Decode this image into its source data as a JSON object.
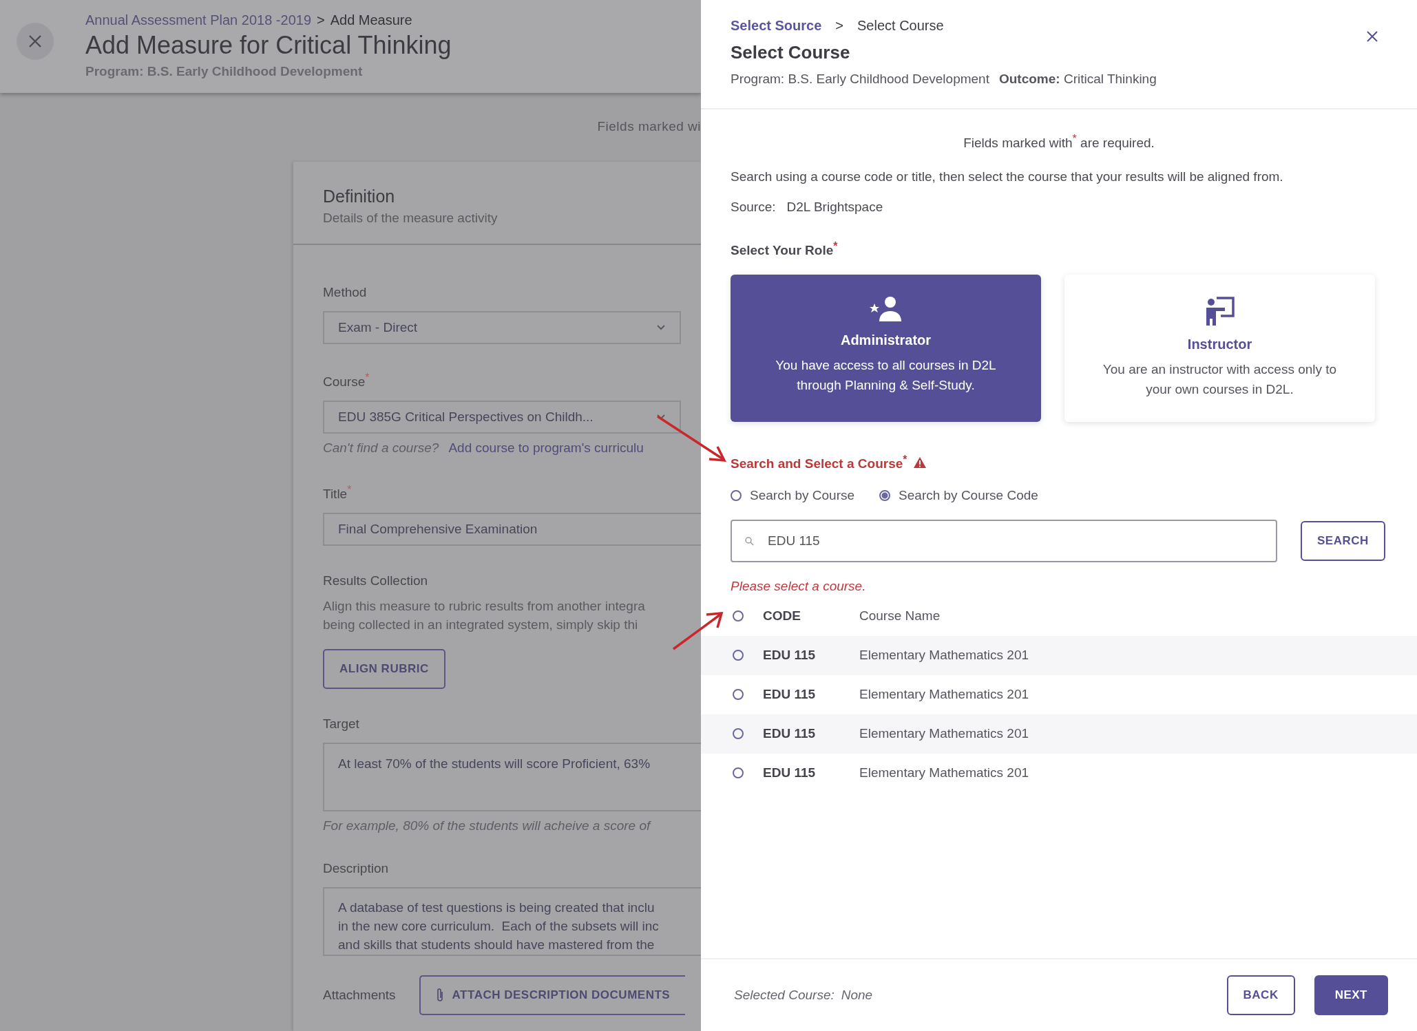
{
  "page": {
    "breadcrumb": {
      "link": "Annual Assessment Plan 2018 -2019",
      "separator": ">",
      "current": "Add Measure"
    },
    "title": "Add Measure for Critical Thinking",
    "program": "Program: B.S. Early Childhood Development",
    "required_note": "Fields marked wi",
    "section": {
      "title": "Definition",
      "subtitle": "Details of the measure activity"
    },
    "method": {
      "label": "Method",
      "value": "Exam - Direct"
    },
    "course": {
      "label": "Course$^{*}$",
      "value": "EDU 385G Critical Perspectives on Childh...",
      "hint": "Can't find a course?",
      "link": "Add course to program's curriculu"
    },
    "title_field": {
      "label": "Title$^{*}$",
      "value": "Final Comprehensive Examination"
    },
    "results": {
      "label": "Results Collection",
      "text": "Align this measure to rubric results from another integra\nbeing collected in an integrated system, simply skip thi",
      "button": "ALIGN RUBRIC"
    },
    "target": {
      "label": "Target",
      "value": "At least 70% of the students will score Proficient, 63%",
      "hint": "For example, 80% of the students will acheive a score of"
    },
    "description": {
      "label": "Description",
      "value": "A database of test questions is being created that inclu\nin the new core curriculum.  Each of the subsets will inc\nand skills that students should have mastered from the"
    },
    "attachments": {
      "label": "Attachments",
      "button": "ATTACH DESCRIPTION DOCUMENTS"
    }
  },
  "drawer": {
    "breadcrumb": {
      "link": "Select Source",
      "separator": ">",
      "current": "Select Course"
    },
    "title": "Select Course",
    "program": "Program: B.S. Early Childhood Development",
    "outcome": "**Outcome:** Critical Thinking",
    "required_note": "Fields marked with$^{*}$ are required.",
    "instructions": "Search using a course code or title, then select the course that your results will be aligned from.",
    "source": {
      "label": "Source:",
      "value": "D2L Brightspace"
    },
    "role_label": "Select Your Role$^{*}$",
    "roles": [
      {
        "kind": "administrator",
        "title": "Administrator",
        "text": "You have access to all courses in D2L through Planning & Self-Study.",
        "selected": true
      },
      {
        "kind": "instructor",
        "title": "Instructor",
        "text": "You are an instructor with access only to your own courses in D2L.",
        "selected": false
      }
    ],
    "search_label": "Search and Select a Course$^{*}$",
    "search_modes": [
      {
        "label": "Search by Course",
        "selected": false
      },
      {
        "label": "Search by Course Code",
        "selected": true
      }
    ],
    "search": {
      "value": "EDU 115",
      "button": "SEARCH"
    },
    "error": "Please select a course.",
    "table": {
      "columns": [
        "CODE",
        "Course Name"
      ],
      "all_selected": false,
      "rows": [
        {
          "code": "EDU 115",
          "name": "Elementary Mathematics 201",
          "selected": false
        },
        {
          "code": "EDU 115",
          "name": "Elementary Mathematics 201",
          "selected": false
        },
        {
          "code": "EDU 115",
          "name": "Elementary Mathematics 201",
          "selected": false
        },
        {
          "code": "EDU 115",
          "name": "Elementary Mathematics 201",
          "selected": false
        }
      ]
    },
    "footer": {
      "label": "Selected Course:",
      "value": "None",
      "buttons": [
        "BACK",
        "NEXT"
      ]
    }
  }
}
